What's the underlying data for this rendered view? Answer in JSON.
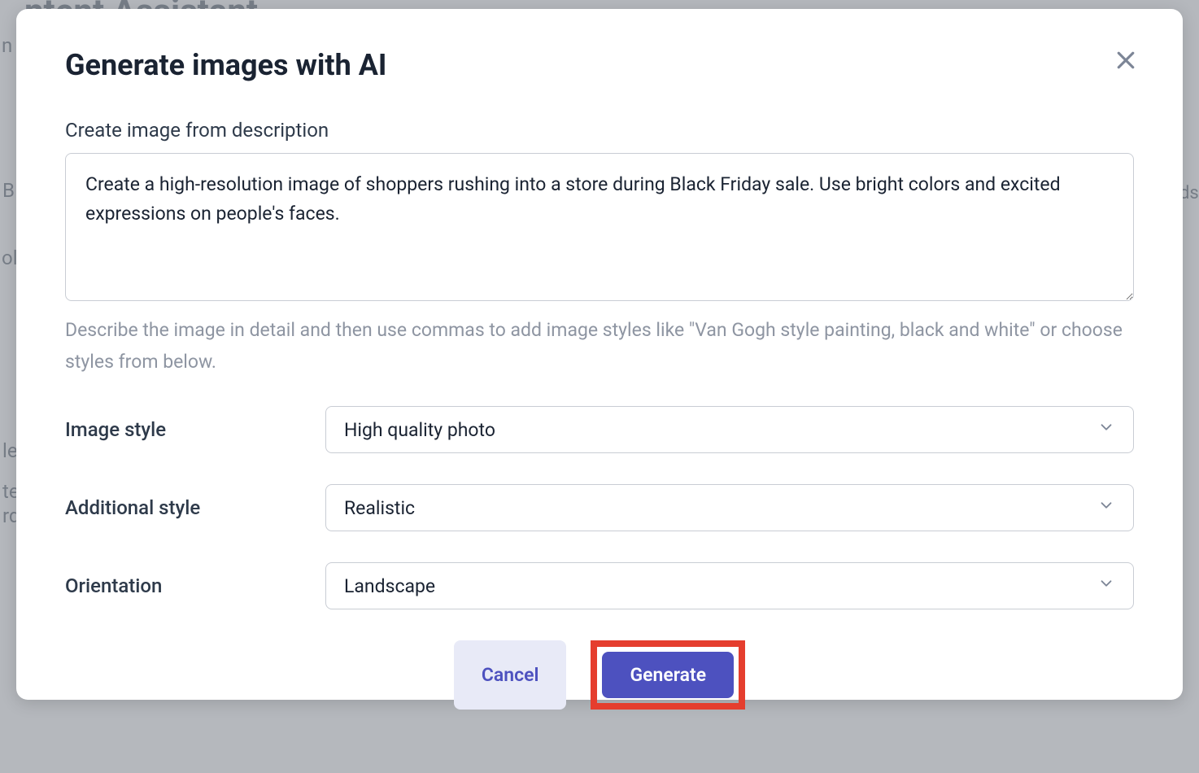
{
  "background": {
    "title_fragment": "ntent Assistant",
    "line1": "n",
    "b": "BI",
    "ds": "ds",
    "ola": "ola",
    "le": "le",
    "te": "te",
    "rd": "rd"
  },
  "modal": {
    "title": "Generate images with AI",
    "description_label": "Create image from description",
    "description_value": "Create a high-resolution image of shoppers rushing into a store during Black Friday sale. Use bright colors and excited expressions on people's faces.",
    "helper_text": "Describe the image in detail and then use commas to add image styles like \"Van Gogh style painting, black and white\" or choose styles from below.",
    "fields": {
      "image_style": {
        "label": "Image style",
        "value": "High quality photo"
      },
      "additional_style": {
        "label": "Additional style",
        "value": "Realistic"
      },
      "orientation": {
        "label": "Orientation",
        "value": "Landscape"
      }
    },
    "buttons": {
      "cancel": "Cancel",
      "generate": "Generate"
    }
  }
}
